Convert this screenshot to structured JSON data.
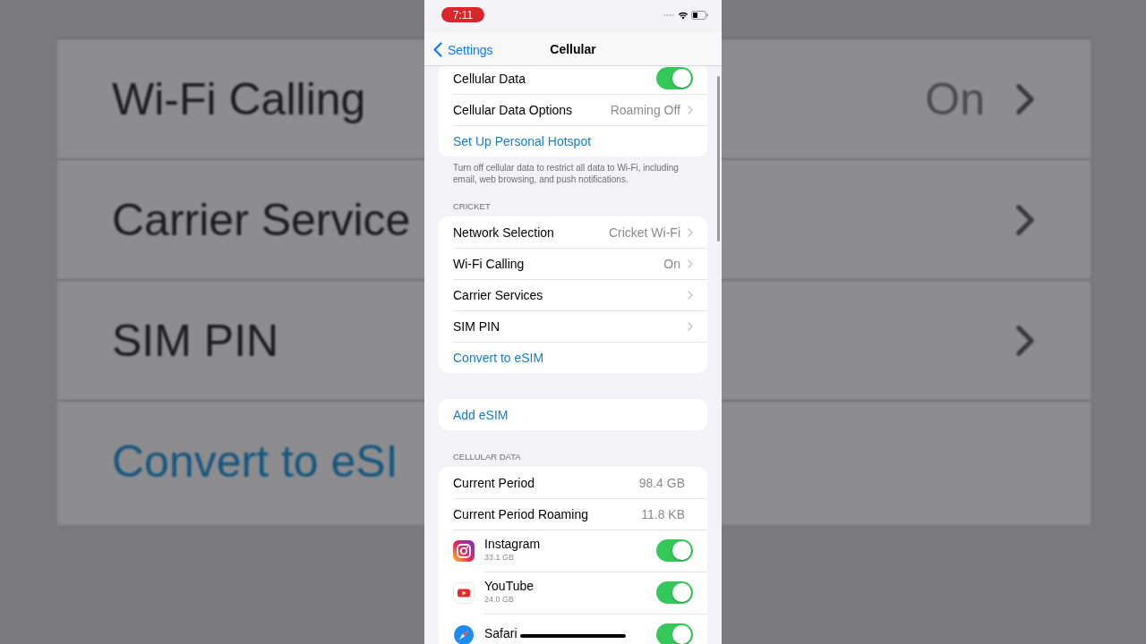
{
  "background": {
    "rows": [
      {
        "kind": "chevron",
        "label": "Wi-Fi Calling",
        "value": "On"
      },
      {
        "kind": "chevron",
        "label": "Carrier Service"
      },
      {
        "kind": "chevron",
        "label": "SIM PIN"
      },
      {
        "kind": "link",
        "label": "Convert to eSI"
      }
    ]
  },
  "status_bar": {
    "time": "7:11"
  },
  "nav": {
    "back": "Settings",
    "title": "Cellular"
  },
  "groups": [
    {
      "rows": [
        {
          "kind": "toggle",
          "label": "Cellular Data",
          "on": true
        },
        {
          "kind": "detail",
          "label": "Cellular Data Options",
          "value": "Roaming Off"
        },
        {
          "kind": "link",
          "label": "Set Up Personal Hotspot"
        }
      ],
      "footer": "Turn off cellular data to restrict all data to Wi-Fi, including email, web browsing, and push notifications."
    },
    {
      "header": "CRICKET",
      "rows": [
        {
          "kind": "detail",
          "label": "Network Selection",
          "value": "Cricket Wi-Fi"
        },
        {
          "kind": "detail",
          "label": "Wi-Fi Calling",
          "value": "On"
        },
        {
          "kind": "detail",
          "label": "Carrier Services"
        },
        {
          "kind": "detail",
          "label": "SIM PIN"
        },
        {
          "kind": "link",
          "label": "Convert to eSIM"
        }
      ]
    },
    {
      "rows": [
        {
          "kind": "link",
          "label": "Add eSIM"
        }
      ]
    },
    {
      "header": "CELLULAR DATA",
      "rows": [
        {
          "kind": "stat",
          "label": "Current Period",
          "value": "98.4 GB"
        },
        {
          "kind": "stat",
          "label": "Current Period Roaming",
          "value": "11.8 KB"
        },
        {
          "kind": "instagram",
          "label": "Instagram",
          "sub": "33.1 GB",
          "on": true
        },
        {
          "kind": "youtube",
          "label": "YouTube",
          "sub": "24.0 GB",
          "on": true
        },
        {
          "kind": "safari",
          "label": "Safari",
          "on": true
        }
      ]
    }
  ]
}
